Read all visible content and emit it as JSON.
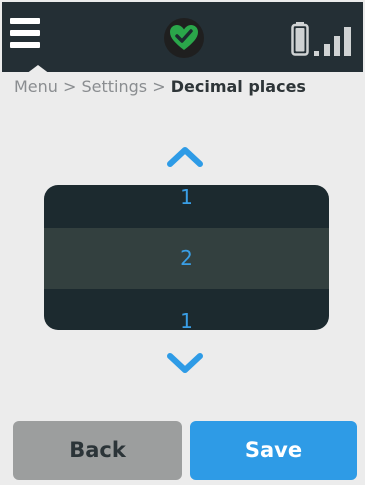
{
  "header": {
    "menu_icon": "hamburger-menu-icon",
    "status_icon": "heart-check-icon",
    "battery_icon": "battery-icon",
    "signal_icon": "signal-bars-icon"
  },
  "breadcrumb": {
    "path": "Menu > Settings > ",
    "current": "Decimal places"
  },
  "picker": {
    "up_icon": "chevron-up-icon",
    "down_icon": "chevron-down-icon",
    "prev_value": "1",
    "selected_value": "2",
    "next_value": "1"
  },
  "buttons": {
    "back_label": "Back",
    "save_label": "Save"
  },
  "colors": {
    "header_bg": "#242f35",
    "accent_blue": "#2e9be6",
    "status_green": "#2aa64a",
    "picker_bg": "#1c2a2f",
    "button_grey": "#9c9e9e"
  }
}
